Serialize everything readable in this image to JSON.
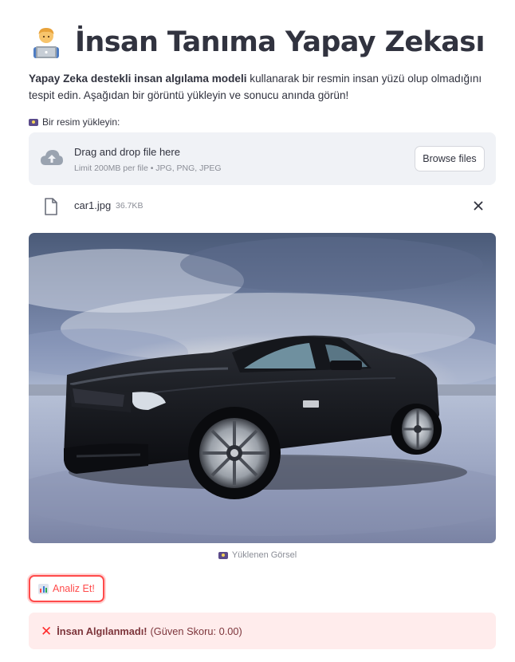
{
  "header": {
    "title": "İnsan Tanıma Yapay Zekası",
    "emoji_icon": "technologist-emoji"
  },
  "description": {
    "bold": "Yapay Zeka destekli insan algılama modeli",
    "rest": " kullanarak bir resmin insan yüzü olup olmadığını tespit edin. Aşağıdan bir görüntü yükleyin ve sonucu anında görün!"
  },
  "uploader": {
    "label": "Bir resim yükleyin:",
    "label_icon": "camera-icon",
    "drop_text": "Drag and drop file here",
    "limit_text": "Limit 200MB per file • JPG, PNG, JPEG",
    "browse_label": "Browse files"
  },
  "file": {
    "name": "car1.jpg",
    "size": "36.7KB"
  },
  "image": {
    "caption": "Yüklenen Görsel"
  },
  "analyze": {
    "label": "Analiz Et!",
    "icon": "bar-chart-icon"
  },
  "result": {
    "status": "İnsan Algılanmadı!",
    "detail": "(Güven Skoru: 0.00)",
    "status_color": "#ff2b2b",
    "background": "#ffecec"
  },
  "colors": {
    "primary": "#ff4b4b",
    "text": "#31333f",
    "muted": "#8a8d96",
    "dropzone": "#f0f2f6"
  }
}
